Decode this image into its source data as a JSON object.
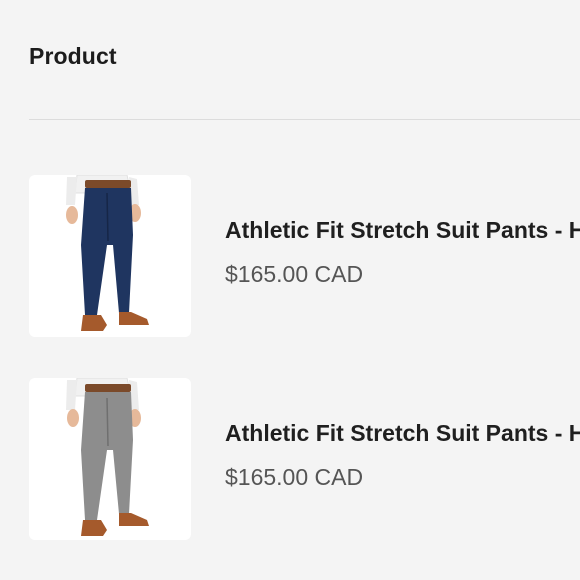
{
  "header": {
    "column_label": "Product"
  },
  "products": [
    {
      "image_icon": "navy-pants-image",
      "title": "Athletic Fit Stretch Suit Pants - H",
      "price": "$165.00 CAD",
      "pants_color": "#1f3560"
    },
    {
      "image_icon": "grey-pants-image",
      "title": "Athletic Fit Stretch Suit Pants - H",
      "price": "$165.00 CAD",
      "pants_color": "#8d8d8d"
    }
  ]
}
